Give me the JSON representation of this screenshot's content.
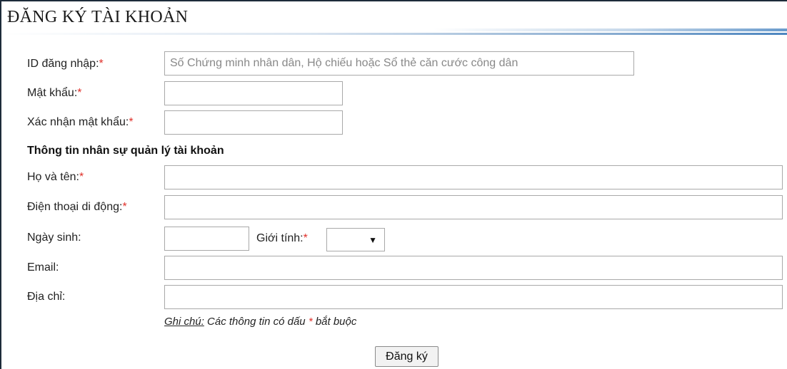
{
  "title": "ĐĂNG KÝ TÀI KHOẢN",
  "required_marker": "*",
  "fields": {
    "login_id": {
      "label": "ID đăng nhập:",
      "value": "",
      "placeholder": "Số Chứng minh nhân dân, Hộ chiếu hoặc Sổ thẻ căn cước công dân"
    },
    "password": {
      "label": "Mật khẩu:",
      "value": ""
    },
    "confirm_password": {
      "label": "Xác nhận mật khẩu:",
      "value": ""
    },
    "full_name": {
      "label": "Họ và tên:",
      "value": ""
    },
    "mobile_phone": {
      "label": "Điện thoại di động:",
      "value": ""
    },
    "birth_date": {
      "label": "Ngày sinh:",
      "value": ""
    },
    "gender": {
      "label": "Giới tính:",
      "selected": ""
    },
    "email": {
      "label": "Email:",
      "value": ""
    },
    "address": {
      "label": "Địa chỉ:",
      "value": ""
    }
  },
  "section_title": "Thông tin nhân sự quản lý tài khoản",
  "note": {
    "label": "Ghi chú:",
    "text_before": " Các thông tin có dấu ",
    "marker": "*",
    "text_after": " bắt buộc"
  },
  "submit_label": "Đăng ký",
  "icons": {
    "select_caret": "▼"
  },
  "colors": {
    "required": "#e0302a",
    "header_accent": "#4d86c0"
  }
}
